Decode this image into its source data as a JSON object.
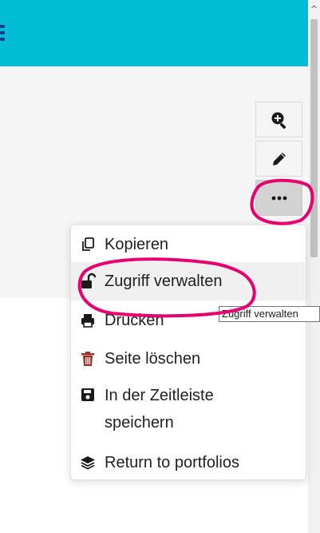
{
  "header": {
    "color": "#00bcd4",
    "menu_icon": "hamburger-icon"
  },
  "scrollbar": {
    "up_arrow": "^"
  },
  "toolbar": {
    "buttons": [
      {
        "icon": "zoom-in-icon"
      },
      {
        "icon": "pencil-icon"
      },
      {
        "icon": "more-options-icon"
      }
    ]
  },
  "menu": {
    "items": [
      {
        "label": "Kopieren",
        "icon": "copy-icon"
      },
      {
        "label": "Zugriff verwalten",
        "icon": "unlock-icon"
      },
      {
        "label": "Drucken",
        "icon": "printer-icon"
      },
      {
        "label": "Seite löschen",
        "icon": "trash-icon"
      },
      {
        "label": "In der Zeitleiste speichern",
        "line1": "In der Zeitleiste",
        "line2": "speichern",
        "icon": "save-icon"
      },
      {
        "label": "Return to portfolios",
        "icon": "layers-icon"
      }
    ]
  },
  "tooltip": {
    "text": "Zugriff verwalten"
  },
  "annotation_color": "#e8006f"
}
